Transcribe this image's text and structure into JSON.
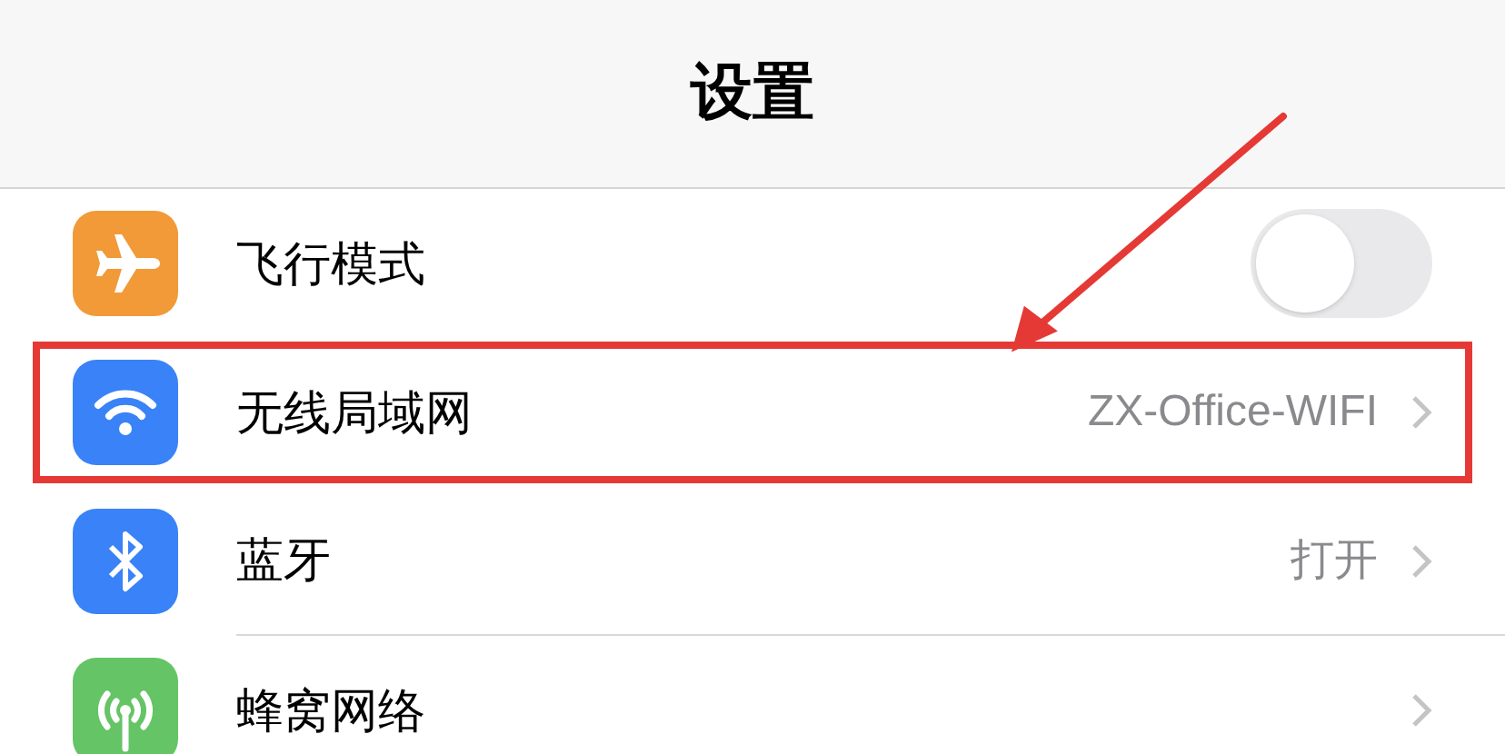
{
  "header": {
    "title": "设置"
  },
  "rows": [
    {
      "kind": "airplane",
      "label": "飞行模式",
      "toggle": {
        "on": false
      },
      "highlighted": false
    },
    {
      "kind": "wifi",
      "label": "无线局域网",
      "value": "ZX-Office-WIFI",
      "highlighted": true
    },
    {
      "kind": "bluetooth",
      "label": "蓝牙",
      "value": "打开",
      "highlighted": false
    },
    {
      "kind": "cellular",
      "label": "蜂窝网络",
      "highlighted": false
    }
  ]
}
